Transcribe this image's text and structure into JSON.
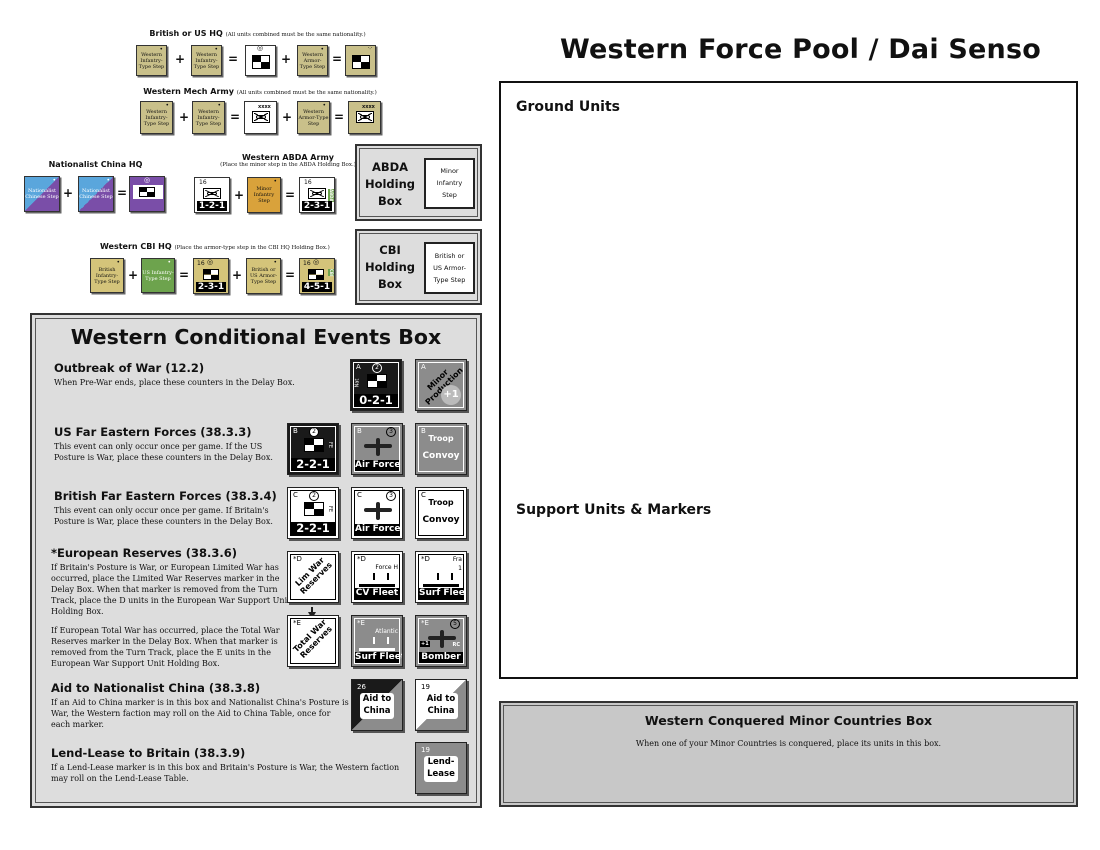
{
  "page_title": "Western Force Pool / Dai Senso",
  "combos": {
    "british_us_hq": {
      "title": "British or US HQ",
      "note": "(All units combined must be the same nationality.)",
      "input1": "Western Infantry-Type Step",
      "input2": "Western Infantry-Type Step",
      "input3": "Western Armor-Type Step"
    },
    "mech_army": {
      "title": "Western Mech Army",
      "note": "(All units combined must be the same nationality.)",
      "input1": "Western Infantry-Type Step",
      "input2": "Western Infantry-Type Step",
      "input3": "Western Armor-Type Step"
    },
    "nat_china_hq": {
      "title": "Nationalist China HQ",
      "input1": "Nationalist Chinese Step",
      "input2": "Nationalist Chinese Step"
    },
    "abda_army": {
      "title": "Western ABDA Army",
      "note": "(Place the minor step in the ABDA Holding Box.)",
      "unit1_value": "1-2-1",
      "unit1_top": "16",
      "input": "Minor Infantry Step",
      "unit2_value": "2-3-1",
      "unit2_top": "16",
      "side_label": "ABDA"
    },
    "cbi_hq": {
      "title": "Western CBI HQ",
      "note": "(Place the armor-type step in the CBI HQ Holding Box.)",
      "input1": "British Infantry-Type Step",
      "input2": "US Infantry-Type Step",
      "unit1_value": "2-3-1",
      "unit1_top": "16",
      "input3": "British or US Armor-Type Step",
      "unit2_value": "4-5-1",
      "unit2_top": "16",
      "side_label": "CBI"
    },
    "ops": {
      "plus": "+",
      "equals": "="
    }
  },
  "holding_boxes": {
    "abda": {
      "label_lines": [
        "ABDA",
        "Holding",
        "Box"
      ],
      "slot_lines": [
        "Minor",
        "Infantry",
        "Step"
      ]
    },
    "cbi": {
      "label_lines": [
        "CBI",
        "Holding",
        "Box"
      ],
      "slot_lines": [
        "British or",
        "US Armor-",
        "Type Step"
      ]
    }
  },
  "events": {
    "title": "Western Conditional Events Box",
    "outbreak": {
      "heading": "Outbreak of War (12.2)",
      "body": "When Pre-War ends, place these counters in the Delay Box.",
      "chit1": {
        "corner": "A",
        "circle": "2",
        "side": "Nat",
        "value": "0-2-1"
      },
      "chit2": {
        "corner": "A",
        "text": "Minor Production",
        "badge": "+1"
      }
    },
    "us_far_east": {
      "heading": "US Far Eastern Forces (38.3.3)",
      "body_lines": [
        "This event can only occur once per game. If the US",
        "Posture is War, place these counters in the Delay Box."
      ],
      "chit1": {
        "corner": "B",
        "circle": "2",
        "tag": "FE",
        "value": "2-2-1"
      },
      "chit2": {
        "corner": "B",
        "circle": "3",
        "value": "Air Force"
      },
      "chit3": {
        "corner": "B",
        "top": "Troop",
        "value": "Convoy"
      }
    },
    "british_far_east": {
      "heading": "British Far Eastern Forces (38.3.4)",
      "body_lines": [
        "This event can only occur once per game. If Britain's",
        "Posture is War, place these counters in the Delay Box."
      ],
      "chit1": {
        "corner": "C",
        "circle": "2",
        "tag": "FE",
        "value": "2-2-1"
      },
      "chit2": {
        "corner": "C",
        "circle": "3",
        "value": "Air Force"
      },
      "chit3": {
        "corner": "C",
        "top": "Troop",
        "value": "Convoy"
      }
    },
    "european_reserves": {
      "heading": "*European Reserves (38.3.6)",
      "body1_lines": [
        "If Britain's Posture is War, or European Limited War has",
        "occurred, place the Limited War Reserves marker in the",
        "Delay Box. When that marker is removed from the Turn",
        "Track, place the D units in the European War Support Unit",
        "Holding Box."
      ],
      "body2_lines": [
        "If European Total War has occurred, place the Total War",
        "Reserves marker in the Delay Box. When that marker is",
        "removed from the Turn Track, place the E units in the",
        "European War Support Unit Holding Box."
      ],
      "chit_lim": {
        "corner": "*D",
        "text": "Lim War Reserves"
      },
      "chit_cv": {
        "corner": "*D",
        "name": "Force H",
        "value": "CV Fleet"
      },
      "chit_surf1": {
        "corner": "*D",
        "name": "Fra",
        "num": "1",
        "value": "Surf Fleet"
      },
      "chit_total": {
        "corner": "*E",
        "text": "Total War Reserves"
      },
      "chit_surf2": {
        "corner": "*E",
        "name": "Atlantic",
        "value": "Surf Fleet"
      },
      "chit_bomber": {
        "corner": "*E",
        "circle": "5",
        "badge": "+1",
        "tag": "RC",
        "value": "Bomber"
      }
    },
    "aid_china": {
      "heading": "Aid to Nationalist China (38.3.8)",
      "body_lines": [
        "If an Aid to China marker is in this box and Nationalist China's Posture is",
        "War, the Western faction may roll on the Aid to China Table, once for",
        "each marker."
      ],
      "chit1": {
        "corner": "26",
        "line1": "Aid to",
        "line2": "China"
      },
      "chit2": {
        "corner": "19",
        "line1": "Aid to",
        "line2": "China"
      }
    },
    "lend_lease": {
      "heading": "Lend-Lease to Britain (38.3.9)",
      "body_lines": [
        "If a Lend-Lease marker is in this box and Britain's Posture is War, the Western faction",
        "may roll on the Lend-Lease Table."
      ],
      "chit1": {
        "corner": "19",
        "line1": "Lend-",
        "line2": "Lease"
      }
    }
  },
  "force_pool": {
    "ground_units": "Ground Units",
    "support_units": "Support Units & Markers"
  },
  "conquered": {
    "title": "Western Conquered Minor Countries Box",
    "body": "When one of your Minor Countries is conquered, place its units in this box."
  },
  "colors": {
    "box_grey": "#dddddd",
    "conquered_grey": "#c8c8c8",
    "western_khaki": "#c9c08a",
    "us_green": "#6da34d",
    "minor_orange": "#d9a23b",
    "chinese_blue": "#5aa6dc",
    "chinese_purple": "#7a4ea8"
  }
}
